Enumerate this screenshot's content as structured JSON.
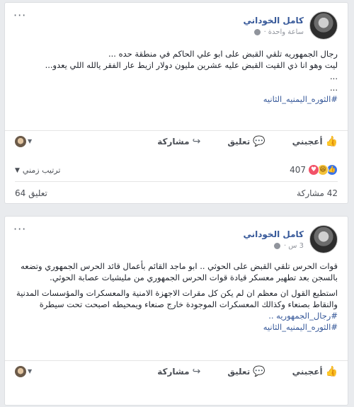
{
  "post1": {
    "author": "كامل الخوداني",
    "time": "ساعة واحدة",
    "lines": [
      "رجال الجمهوريه تلقي القبض على ابو علي الحاكم في منطقة حده ...",
      "ليت وهو انا ذي القيت القبض عليه عشرين مليون دولار ازيط عار الفقر يالله اللي يعدو...",
      "...",
      "..."
    ],
    "hashtag": "#الثوره_اليمنيه_الثانيه",
    "actions": {
      "like": "أعجبني",
      "comment": "تعليق",
      "share": "مشاركة"
    },
    "ranking": "ترتيب زمني",
    "reactions_count": "407",
    "shares": "42 مشاركة",
    "comments": "64 تعليق"
  },
  "post2": {
    "author": "كامل الخوداني",
    "time": "3 س",
    "paragraph1": "قوات الحرس تلقي القبض على الحوثي .. ابو ماجد القائم بأعمال قائد الحرس الجمهوري وتضعه بالسجن بعد تطهير معسكر قيادة قوات الحرس الجمهوري من مليشيات عصابة الحوثي.",
    "paragraph2": "استطيع القول ان معظم ان لم يكن كل مقرات الاجهزة الامنية والمعسكرات والمؤسسات المدنية والنقاط بصنعاء وكذالك المعسكرات الموجودة خارج صنعاء ويمحيطه اصبحت تحت سيطرة",
    "hashtag1": "#رجال_الجمهوريه ..",
    "hashtag2": "#الثوره_اليمنيه_الثانيه",
    "actions": {
      "like": "أعجبني",
      "comment": "تعليق",
      "share": "مشاركة"
    }
  }
}
